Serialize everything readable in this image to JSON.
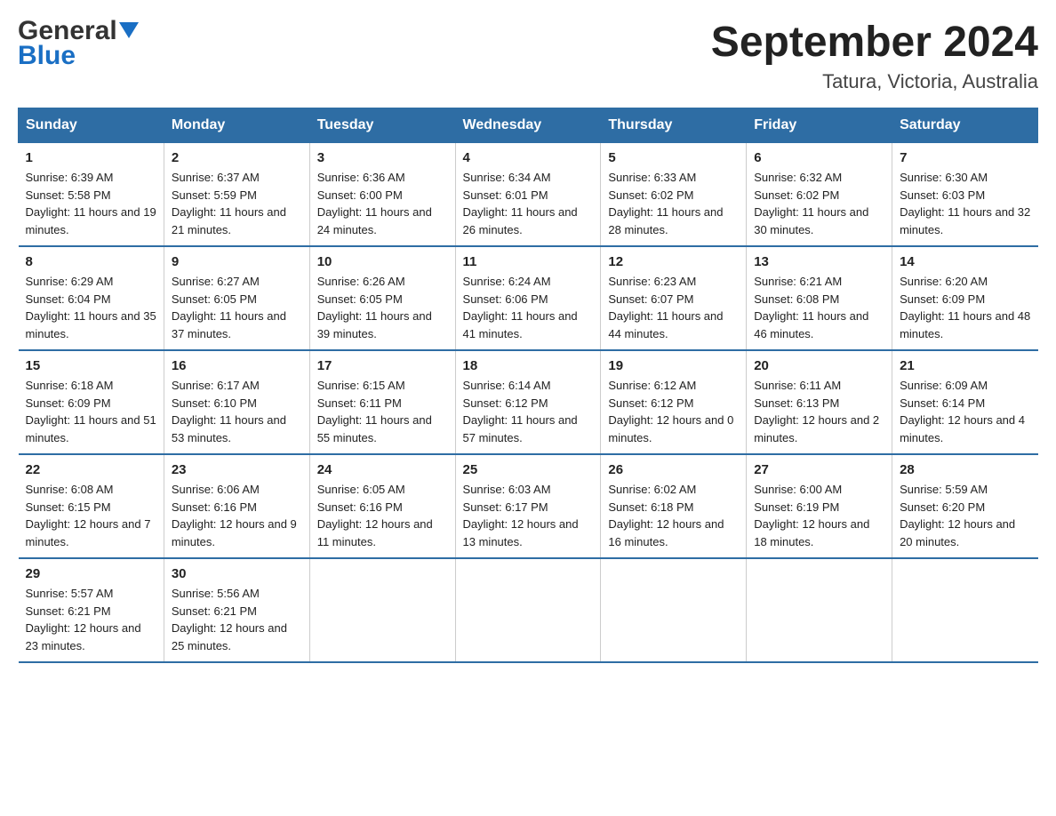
{
  "header": {
    "logo_general": "General",
    "logo_blue": "Blue",
    "month_title": "September 2024",
    "location": "Tatura, Victoria, Australia"
  },
  "days_of_week": [
    "Sunday",
    "Monday",
    "Tuesday",
    "Wednesday",
    "Thursday",
    "Friday",
    "Saturday"
  ],
  "weeks": [
    [
      {
        "day": "1",
        "sunrise": "6:39 AM",
        "sunset": "5:58 PM",
        "daylight": "11 hours and 19 minutes."
      },
      {
        "day": "2",
        "sunrise": "6:37 AM",
        "sunset": "5:59 PM",
        "daylight": "11 hours and 21 minutes."
      },
      {
        "day": "3",
        "sunrise": "6:36 AM",
        "sunset": "6:00 PM",
        "daylight": "11 hours and 24 minutes."
      },
      {
        "day": "4",
        "sunrise": "6:34 AM",
        "sunset": "6:01 PM",
        "daylight": "11 hours and 26 minutes."
      },
      {
        "day": "5",
        "sunrise": "6:33 AM",
        "sunset": "6:02 PM",
        "daylight": "11 hours and 28 minutes."
      },
      {
        "day": "6",
        "sunrise": "6:32 AM",
        "sunset": "6:02 PM",
        "daylight": "11 hours and 30 minutes."
      },
      {
        "day": "7",
        "sunrise": "6:30 AM",
        "sunset": "6:03 PM",
        "daylight": "11 hours and 32 minutes."
      }
    ],
    [
      {
        "day": "8",
        "sunrise": "6:29 AM",
        "sunset": "6:04 PM",
        "daylight": "11 hours and 35 minutes."
      },
      {
        "day": "9",
        "sunrise": "6:27 AM",
        "sunset": "6:05 PM",
        "daylight": "11 hours and 37 minutes."
      },
      {
        "day": "10",
        "sunrise": "6:26 AM",
        "sunset": "6:05 PM",
        "daylight": "11 hours and 39 minutes."
      },
      {
        "day": "11",
        "sunrise": "6:24 AM",
        "sunset": "6:06 PM",
        "daylight": "11 hours and 41 minutes."
      },
      {
        "day": "12",
        "sunrise": "6:23 AM",
        "sunset": "6:07 PM",
        "daylight": "11 hours and 44 minutes."
      },
      {
        "day": "13",
        "sunrise": "6:21 AM",
        "sunset": "6:08 PM",
        "daylight": "11 hours and 46 minutes."
      },
      {
        "day": "14",
        "sunrise": "6:20 AM",
        "sunset": "6:09 PM",
        "daylight": "11 hours and 48 minutes."
      }
    ],
    [
      {
        "day": "15",
        "sunrise": "6:18 AM",
        "sunset": "6:09 PM",
        "daylight": "11 hours and 51 minutes."
      },
      {
        "day": "16",
        "sunrise": "6:17 AM",
        "sunset": "6:10 PM",
        "daylight": "11 hours and 53 minutes."
      },
      {
        "day": "17",
        "sunrise": "6:15 AM",
        "sunset": "6:11 PM",
        "daylight": "11 hours and 55 minutes."
      },
      {
        "day": "18",
        "sunrise": "6:14 AM",
        "sunset": "6:12 PM",
        "daylight": "11 hours and 57 minutes."
      },
      {
        "day": "19",
        "sunrise": "6:12 AM",
        "sunset": "6:12 PM",
        "daylight": "12 hours and 0 minutes."
      },
      {
        "day": "20",
        "sunrise": "6:11 AM",
        "sunset": "6:13 PM",
        "daylight": "12 hours and 2 minutes."
      },
      {
        "day": "21",
        "sunrise": "6:09 AM",
        "sunset": "6:14 PM",
        "daylight": "12 hours and 4 minutes."
      }
    ],
    [
      {
        "day": "22",
        "sunrise": "6:08 AM",
        "sunset": "6:15 PM",
        "daylight": "12 hours and 7 minutes."
      },
      {
        "day": "23",
        "sunrise": "6:06 AM",
        "sunset": "6:16 PM",
        "daylight": "12 hours and 9 minutes."
      },
      {
        "day": "24",
        "sunrise": "6:05 AM",
        "sunset": "6:16 PM",
        "daylight": "12 hours and 11 minutes."
      },
      {
        "day": "25",
        "sunrise": "6:03 AM",
        "sunset": "6:17 PM",
        "daylight": "12 hours and 13 minutes."
      },
      {
        "day": "26",
        "sunrise": "6:02 AM",
        "sunset": "6:18 PM",
        "daylight": "12 hours and 16 minutes."
      },
      {
        "day": "27",
        "sunrise": "6:00 AM",
        "sunset": "6:19 PM",
        "daylight": "12 hours and 18 minutes."
      },
      {
        "day": "28",
        "sunrise": "5:59 AM",
        "sunset": "6:20 PM",
        "daylight": "12 hours and 20 minutes."
      }
    ],
    [
      {
        "day": "29",
        "sunrise": "5:57 AM",
        "sunset": "6:21 PM",
        "daylight": "12 hours and 23 minutes."
      },
      {
        "day": "30",
        "sunrise": "5:56 AM",
        "sunset": "6:21 PM",
        "daylight": "12 hours and 25 minutes."
      },
      null,
      null,
      null,
      null,
      null
    ]
  ]
}
